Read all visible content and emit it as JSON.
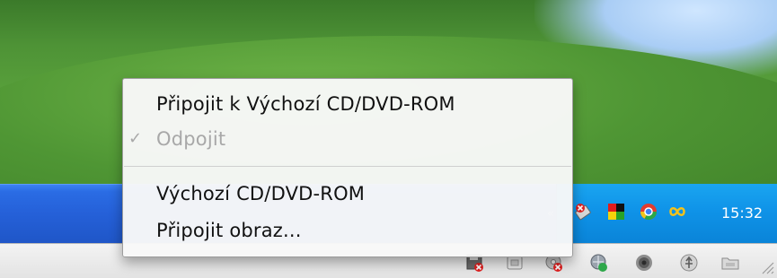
{
  "context_menu": {
    "items": [
      {
        "label": "Připojit k Výchozí CD/DVD-ROM",
        "enabled": true,
        "checked": false
      },
      {
        "label": "Odpojit",
        "enabled": false,
        "checked": true
      },
      {
        "label": "Výchozí CD/DVD-ROM",
        "enabled": true,
        "checked": false
      },
      {
        "label": "Připojit obraz...",
        "enabled": true,
        "checked": false
      }
    ],
    "check_glyph": "✓"
  },
  "taskbar": {
    "clock": "15:32",
    "tray_icons": [
      "usb-disconnected-icon",
      "color-flag-icon",
      "chrome-browser-icon",
      "loop-connectivity-icon"
    ],
    "chevron_glyph": "«"
  },
  "vm_statusbar": {
    "icons": [
      "floppy-disconnected-icon",
      "hard-disk-icon",
      "cd-dvd-disconnected-icon",
      "network-icon",
      "sound-icon",
      "usb-icon",
      "shared-folder-icon"
    ]
  },
  "colors": {
    "taskbar_blue": "#2560d8",
    "tray_blue": "#0f93e8",
    "disabled_text": "#a8a8a8"
  }
}
